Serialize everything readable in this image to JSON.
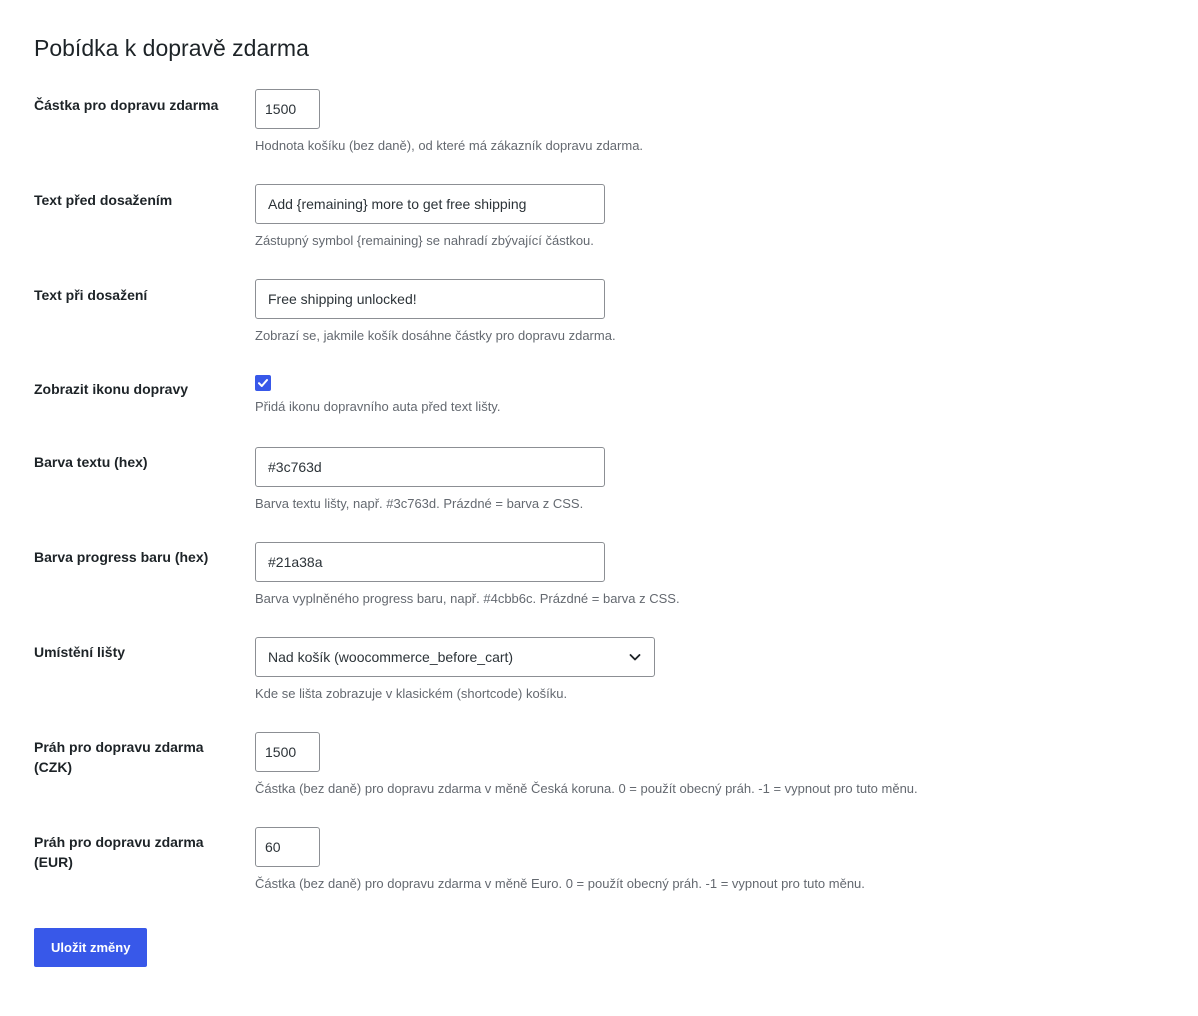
{
  "page": {
    "title": "Pobídka k dopravě zdarma"
  },
  "fields": {
    "threshold": {
      "label": "Částka pro dopravu zdarma",
      "value": "1500",
      "description": "Hodnota košíku (bez daně), od které má zákazník dopravu zdarma."
    },
    "text_before": {
      "label": "Text před dosažením",
      "value": "Add {remaining} more to get free shipping",
      "description": "Zástupný symbol {remaining} se nahradí zbývající částkou."
    },
    "text_after": {
      "label": "Text při dosažení",
      "value": "Free shipping unlocked!",
      "description": "Zobrazí se, jakmile košík dosáhne částky pro dopravu zdarma."
    },
    "show_icon": {
      "label": "Zobrazit ikonu dopravy",
      "checked": true,
      "description": "Přidá ikonu dopravního auta před text lišty."
    },
    "text_color": {
      "label": "Barva textu (hex)",
      "value": "#3c763d",
      "description": "Barva textu lišty, např. #3c763d. Prázdné = barva z CSS."
    },
    "bar_color": {
      "label": "Barva progress baru (hex)",
      "value": "#21a38a",
      "description": "Barva vyplněného progress baru, např. #4cbb6c. Prázdné = barva z CSS."
    },
    "placement": {
      "label": "Umístění lišty",
      "selected": "Nad košík (woocommerce_before_cart)",
      "description": "Kde se lišta zobrazuje v klasickém (shortcode) košíku."
    },
    "threshold_czk": {
      "label": "Práh pro dopravu zdarma (CZK)",
      "value": "1500",
      "description": "Částka (bez daně) pro dopravu zdarma v měně Česká koruna. 0 = použít obecný práh. -1 = vypnout pro tuto měnu."
    },
    "threshold_eur": {
      "label": "Práh pro dopravu zdarma (EUR)",
      "value": "60",
      "description": "Částka (bez daně) pro dopravu zdarma v měně Euro. 0 = použít obecný práh. -1 = vypnout pro tuto měnu."
    }
  },
  "actions": {
    "save_label": "Uložit změny"
  },
  "colors": {
    "accent": "#3858e9",
    "description_text": "#646970",
    "input_border": "#8c8f94"
  },
  "icons": {
    "checkbox": "checkmark-icon",
    "select": "chevron-down-icon"
  }
}
